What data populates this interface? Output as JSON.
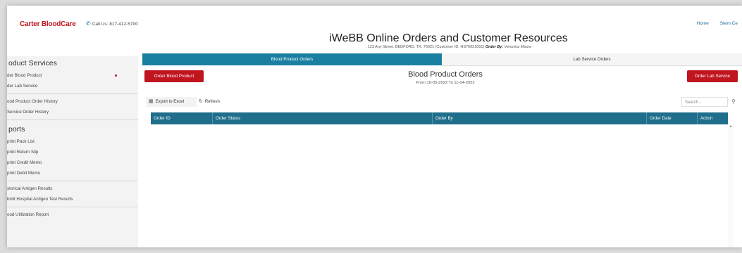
{
  "header": {
    "brand": "Carter BloodCare",
    "phone": "Call Us: 817-412-5700",
    "nav": [
      "Home",
      "Stem Ce"
    ],
    "title": "iWeBB Online Orders and Customer Resources",
    "address": ", 123 Any Street, BEDFORD, TX, 76021 (Customer ID: HS76021001)",
    "order_by_label": "Order By:",
    "order_by_value": "Veronica Moore"
  },
  "sidebar": {
    "sections": [
      {
        "title": "oduct Services",
        "items": [
          "der Blood Product",
          "der Lab Service"
        ]
      },
      {
        "title": "",
        "items": [
          "ood Product Order History",
          "Service Order History"
        ]
      },
      {
        "title": "ports",
        "items": [
          "print Pack List",
          "print Return Slip",
          "print Credit Memo",
          "print Debit Memo"
        ]
      },
      {
        "title": "",
        "items": [
          "storical Antigen Results",
          "bmit Hospital Antigen Test Results"
        ]
      },
      {
        "title": "",
        "items": [
          "ood Utilization Report"
        ]
      }
    ]
  },
  "main": {
    "tabs": [
      "Blood Product Orders",
      "Lab Service Orders"
    ],
    "order_blood_button": "Order Blood Product",
    "order_lab_button": "Order Lab Service",
    "section_title": "Blood Product Orders",
    "date_range": "From 10-05-2022 To 11-04-2022",
    "export_label": "Export to Excel",
    "refresh_label": "Refresh",
    "search_placeholder": "Search...",
    "columns": [
      "Order ID",
      "Order Status",
      "Order By",
      "Order Date",
      "Action"
    ]
  },
  "colors": {
    "brand_red": "#c0141f",
    "tab_active": "#1a7fa0",
    "table_header": "#1f6e8c"
  },
  "icons": [
    "phone-icon",
    "excel-icon",
    "refresh-icon",
    "search-icon"
  ]
}
